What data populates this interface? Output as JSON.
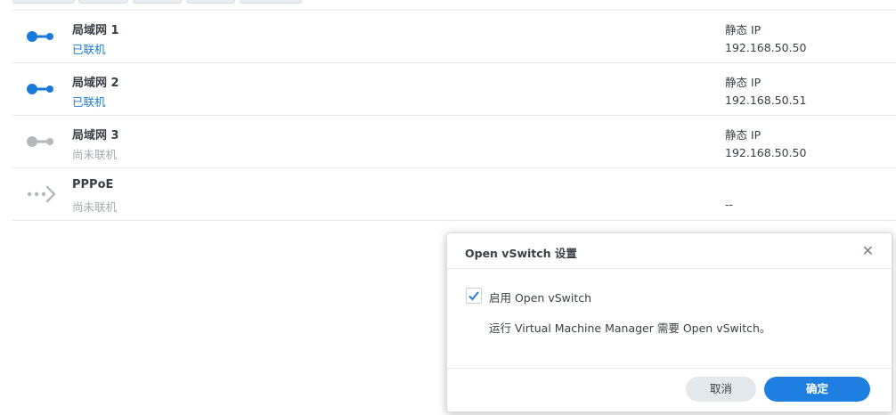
{
  "interfaces": [
    {
      "name": "局域网 1",
      "status": "已联机",
      "connected": true,
      "ip_mode": "静态 IP",
      "ip": "192.168.50.50",
      "icon": "lan-connected-icon"
    },
    {
      "name": "局域网 2",
      "status": "已联机",
      "connected": true,
      "ip_mode": "静态 IP",
      "ip": "192.168.50.51",
      "icon": "lan-connected-icon"
    },
    {
      "name": "局域网 3",
      "status": "尚未联机",
      "connected": false,
      "ip_mode": "静态 IP",
      "ip": "192.168.50.50",
      "icon": "lan-disconnected-icon"
    },
    {
      "name": "PPPoE",
      "status": "尚未联机",
      "connected": false,
      "ip_mode": "",
      "ip": "--",
      "icon": "pppoe-icon"
    }
  ],
  "dialog": {
    "title": "Open vSwitch 设置",
    "close_icon": "close-icon",
    "checkbox_label": "启用 Open vSwitch",
    "checkbox_checked": true,
    "description": "运行 Virtual Machine Manager 需要 Open vSwitch。",
    "cancel_label": "取消",
    "ok_label": "确定"
  },
  "colors": {
    "accent": "#1f7fe0",
    "connected": "#1a7ad9",
    "disconnected": "#a4aab0"
  }
}
